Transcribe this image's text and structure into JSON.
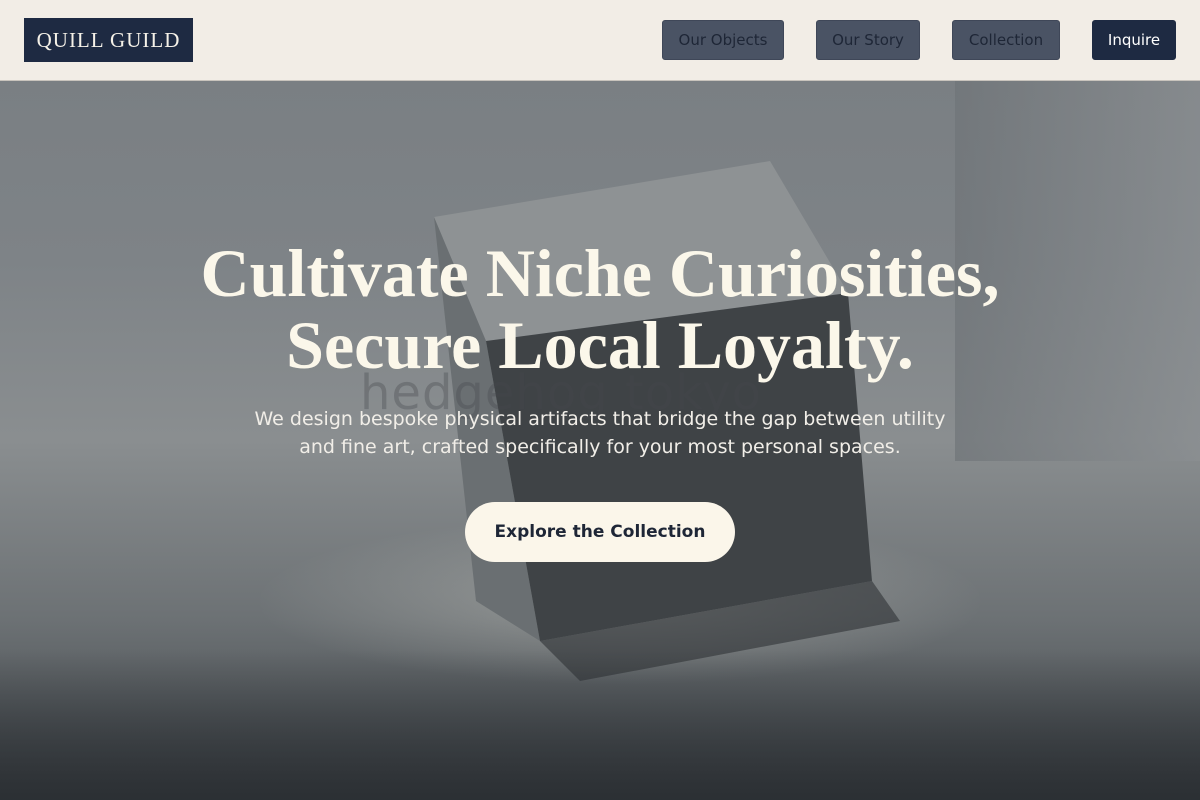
{
  "header": {
    "logo": "QUILL GUILD",
    "nav": {
      "objects": "Our Objects",
      "story": "Our Story",
      "collection": "Collection",
      "inquire": "Inquire"
    }
  },
  "hero": {
    "watermark": "hedgehog tokyo",
    "headline_line1": "Cultivate Niche Curiosities,",
    "headline_line2": "Secure Local Loyalty.",
    "subtext_line1": "We design bespoke physical artifacts that bridge the gap between utility",
    "subtext_line2": "and fine art, crafted specifically for your most personal spaces.",
    "cta": "Explore the Collection"
  },
  "colors": {
    "brand_navy": "#1e2a42",
    "header_bg": "#f2ede6",
    "nav_button": "#4a5364",
    "cream": "#fbf6ea"
  }
}
